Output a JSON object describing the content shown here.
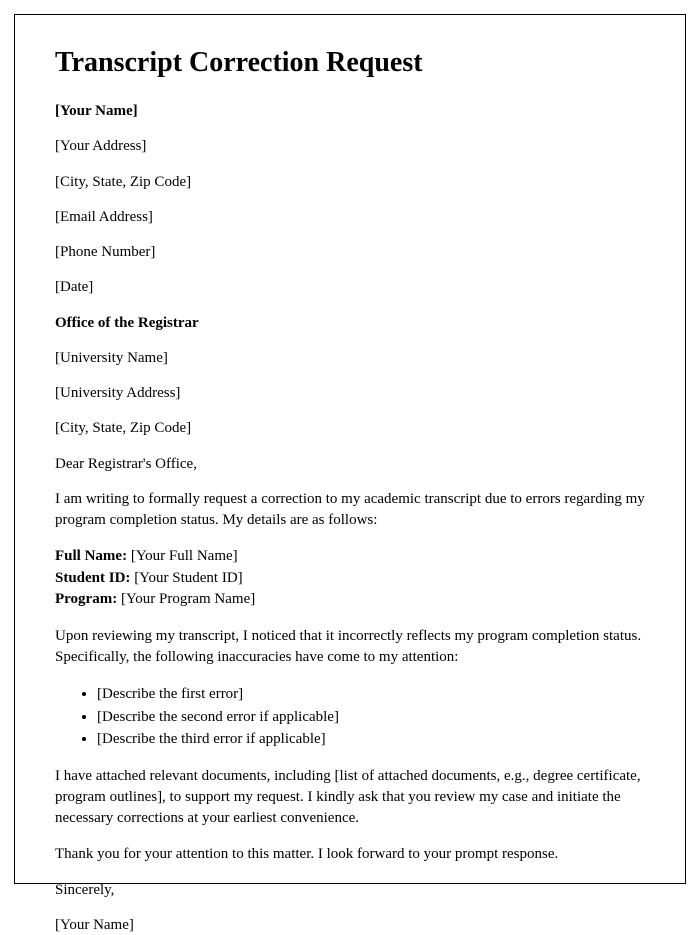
{
  "title": "Transcript Correction Request",
  "sender": {
    "name": "[Your Name]",
    "address": "[Your Address]",
    "cityStateZip": "[City, State, Zip Code]",
    "email": "[Email Address]",
    "phone": "[Phone Number]",
    "date": "[Date]"
  },
  "recipient": {
    "office": "Office of the Registrar",
    "universityName": "[University Name]",
    "universityAddress": "[University Address]",
    "cityStateZip": "[City, State, Zip Code]"
  },
  "salutation": "Dear Registrar's Office,",
  "intro": "I am writing to formally request a correction to my academic transcript due to errors regarding my program completion status. My details are as follows:",
  "details": {
    "fullNameLabel": "Full Name:",
    "fullNameValue": " [Your Full Name]",
    "studentIdLabel": "Student ID:",
    "studentIdValue": " [Your Student ID]",
    "programLabel": "Program:",
    "programValue": " [Your Program Name]"
  },
  "reviewText": "Upon reviewing my transcript, I noticed that it incorrectly reflects my program completion status. Specifically, the following inaccuracies have come to my attention:",
  "errors": [
    "[Describe the first error]",
    "[Describe the second error if applicable]",
    "[Describe the third error if applicable]"
  ],
  "attachmentsText": "I have attached relevant documents, including [list of attached documents, e.g., degree certificate, program outlines], to support my request. I kindly ask that you review my case and initiate the necessary corrections at your earliest convenience.",
  "thanks": "Thank you for your attention to this matter. I look forward to your prompt response.",
  "closing": "Sincerely,",
  "signature": "[Your Name]"
}
